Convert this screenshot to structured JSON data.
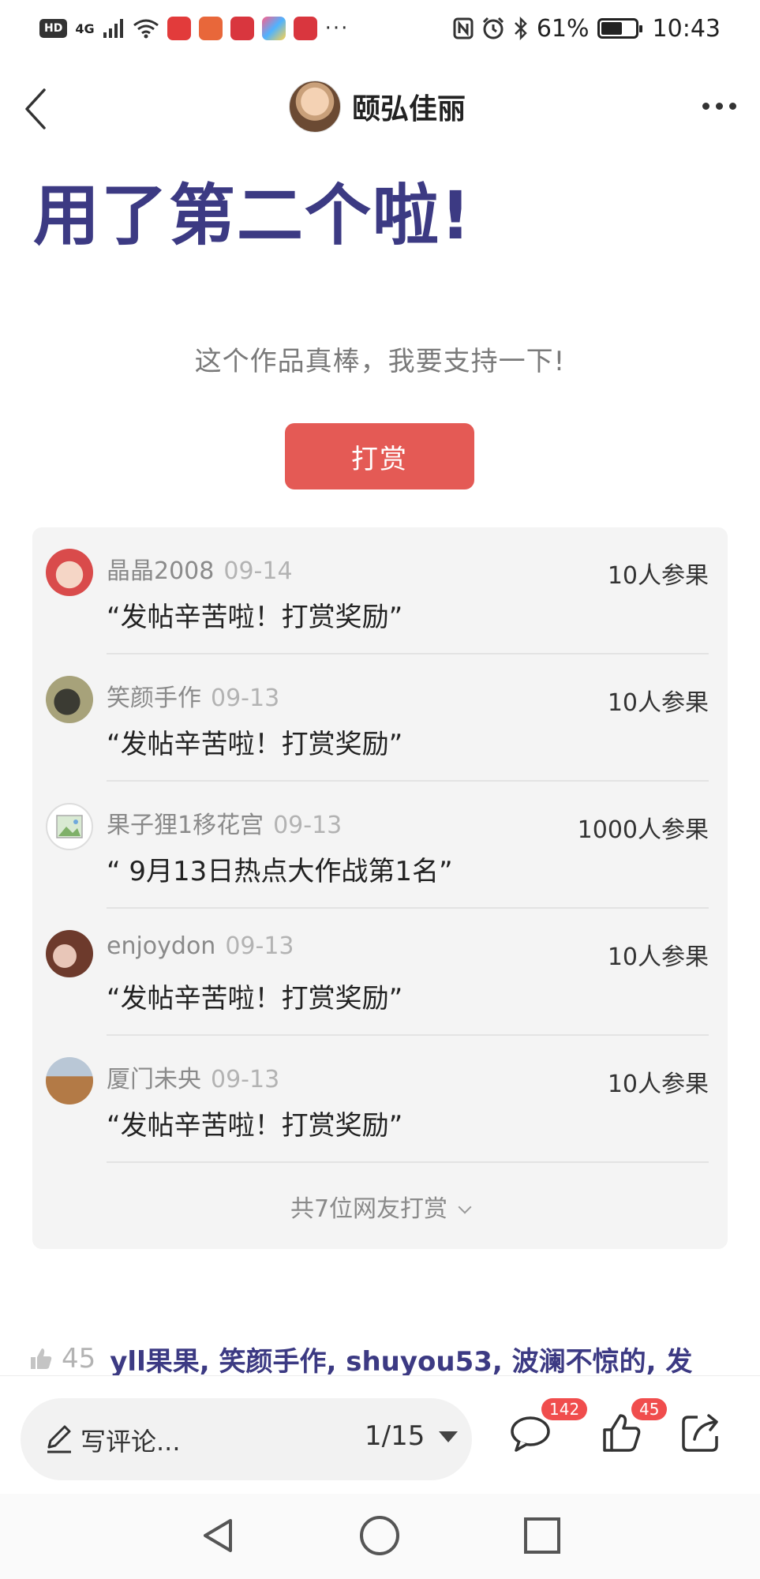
{
  "status_bar": {
    "hd": "HD",
    "network": "4G",
    "notification_more": "···",
    "battery": "61%",
    "time": "10:43"
  },
  "header": {
    "author_name": "颐弘佳丽"
  },
  "post": {
    "title": "用了第二个啦!",
    "support_text": "这个作品真棒，我要支持一下!",
    "reward_button": "打赏"
  },
  "rewards": {
    "items": [
      {
        "name": "晶晶2008",
        "date": "09-14",
        "count": "10人参果",
        "message": "“发帖辛苦啦！打赏奖励”"
      },
      {
        "name": "笑颜手作",
        "date": "09-13",
        "count": "10人参果",
        "message": "“发帖辛苦啦！打赏奖励”"
      },
      {
        "name": "果子狸1移花宫",
        "date": "09-13",
        "count": "1000人参果",
        "message": "“ 9月13日热点大作战第1名”"
      },
      {
        "name": "enjoydon",
        "date": "09-13",
        "count": "10人参果",
        "message": "“发帖辛苦啦！打赏奖励”"
      },
      {
        "name": "厦门未央",
        "date": "09-13",
        "count": "10人参果",
        "message": "“发帖辛苦啦！打赏奖励”"
      }
    ],
    "more_label": "共7位网友打赏"
  },
  "likes": {
    "count": "45",
    "names": "yll果果, 笑颜手作, shuyou53, 波澜不惊的, 发"
  },
  "bottom_bar": {
    "comment_placeholder": "写评论...",
    "page_indicator": "1/15",
    "comment_badge": "142",
    "like_badge": "45"
  },
  "icons": {
    "back": "back-arrow-icon",
    "more": "more-dots-icon",
    "comment": "comment-bubble-icon",
    "like": "thumbs-up-icon",
    "share": "share-icon"
  },
  "colors": {
    "title": "#3c3a83",
    "reward_button": "#e45a55",
    "badge": "#f04d4d"
  }
}
